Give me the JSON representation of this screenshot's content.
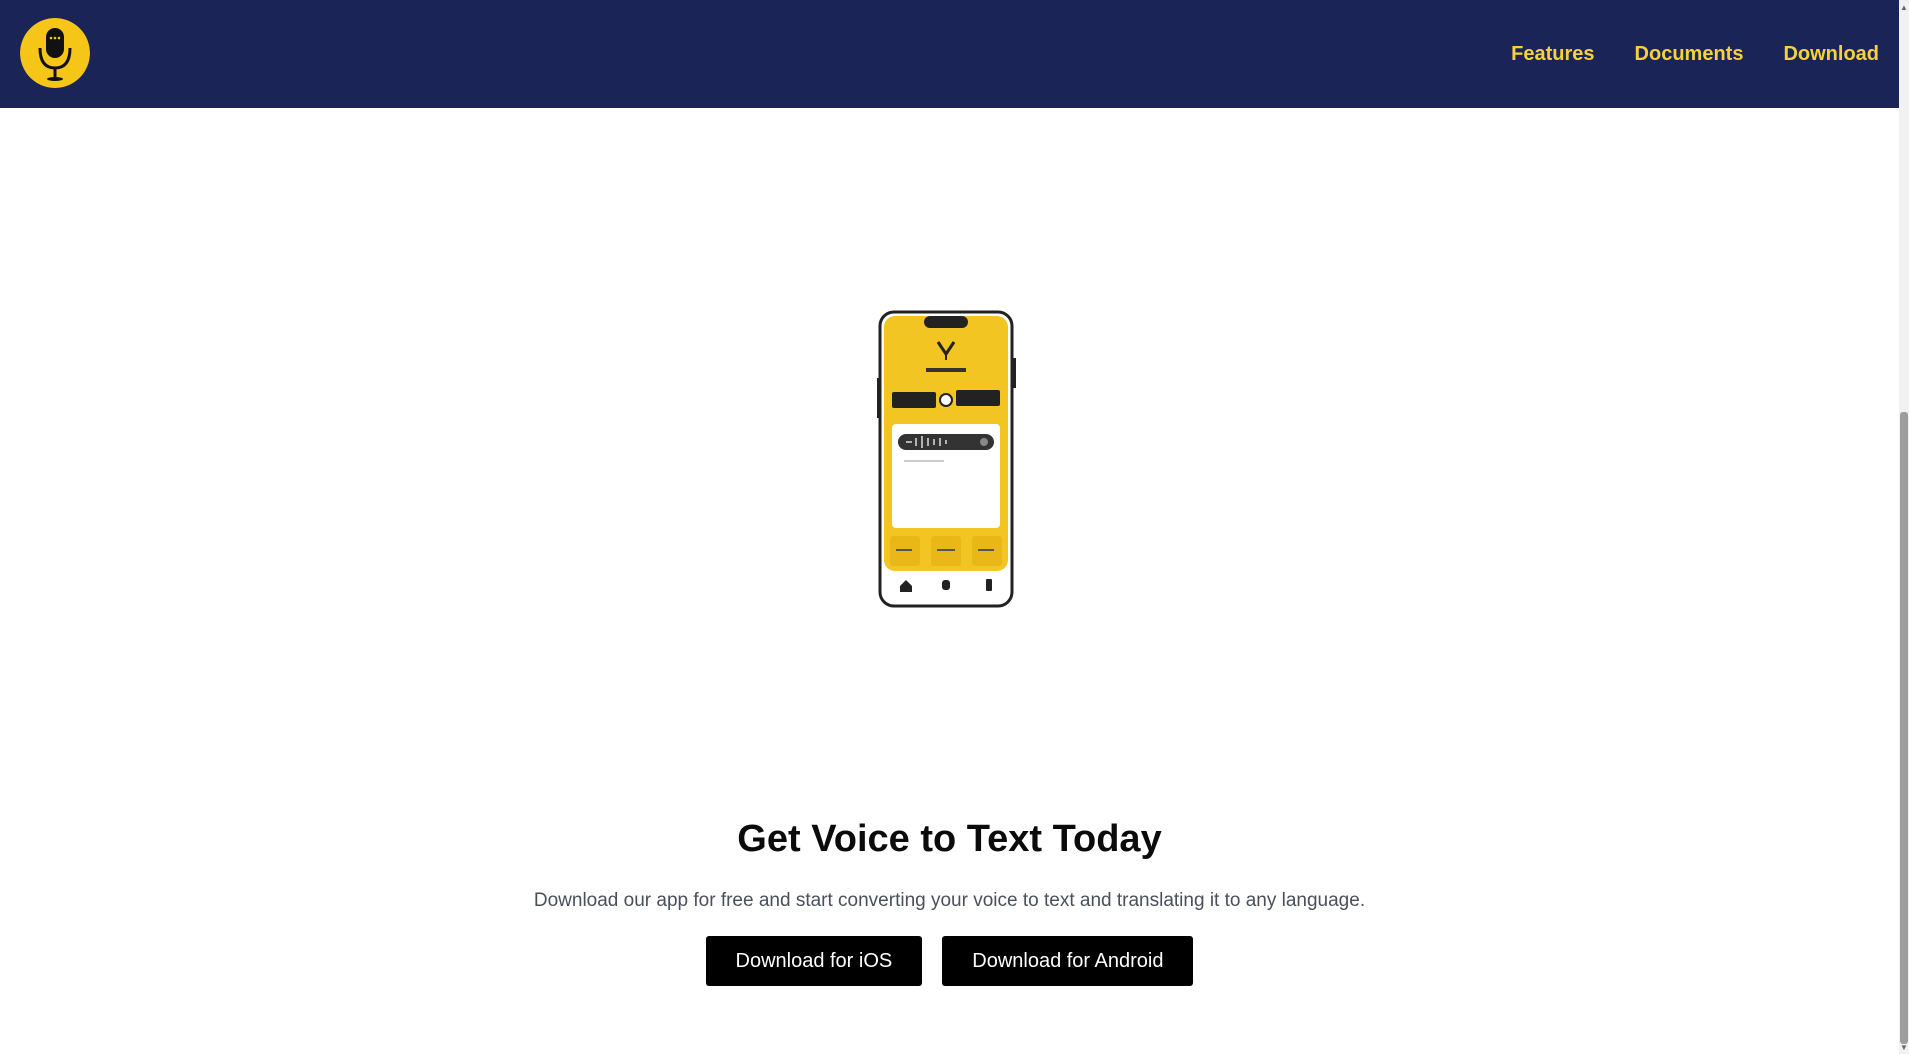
{
  "header": {
    "logo_icon": "microphone-logo-icon",
    "nav": [
      {
        "label": "Features"
      },
      {
        "label": "Documents"
      },
      {
        "label": "Download"
      }
    ]
  },
  "hero": {
    "image_icon": "phone-app-illustration",
    "title": "Get Voice to Text Today",
    "subtitle": "Download our app for free and start converting your voice to text and translating it to any language.",
    "buttons": {
      "ios": "Download for iOS",
      "android": "Download for Android"
    }
  },
  "colors": {
    "header_bg": "#1a2456",
    "accent_yellow": "#f5d23b",
    "button_bg": "#000000",
    "button_text": "#ffffff"
  }
}
